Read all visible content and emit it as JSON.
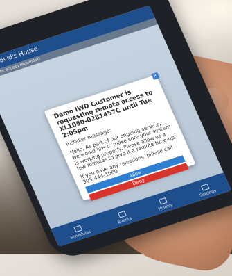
{
  "app": {
    "title": "David's House",
    "subtitle": "Remote access requested"
  },
  "dialog": {
    "close_glyph": "×",
    "title": "Demo IWD Customer is requesting remote access to XL1050-0281457C until Tue 2:05pm",
    "installer_label": "Installer message:",
    "message": "Hello, As part of our ongoing service, we would like to make sure your system is working properly. Please allow us a few minutes to give it a remote tune-up.",
    "contact": "If you have any questions, please call 303-444-1000",
    "allow_label": "Allow",
    "deny_label": "Deny"
  },
  "nav": {
    "items": [
      {
        "label": "Schedules",
        "icon": "calendar-icon"
      },
      {
        "label": "Events",
        "icon": "events-icon"
      },
      {
        "label": "History",
        "icon": "history-icon"
      },
      {
        "label": "Settings",
        "icon": "settings-icon"
      }
    ]
  },
  "colors": {
    "app_bar": "#1f4e8c",
    "allow": "#2f7fd0",
    "deny": "#d9342b"
  }
}
